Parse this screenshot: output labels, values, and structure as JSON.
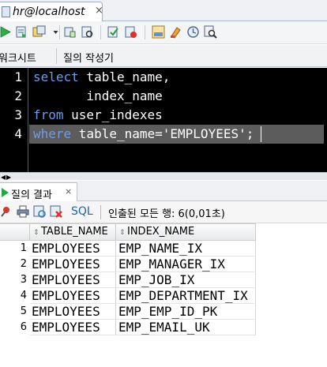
{
  "window": {
    "connection_tab_title": "hr@localhost",
    "connection_tab_close": "×"
  },
  "toolbar": {
    "icons": [
      "run-statement-icon",
      "run-script-icon",
      "commit-icon",
      "dropdown-icon",
      "autotrace-icon",
      "explain-plan-icon",
      "commit-icon",
      "rollback-icon",
      "sql-tuning-icon",
      "clear-icon",
      "history-icon",
      "find-icon"
    ]
  },
  "worksheet_tabs": {
    "worksheet": "워크시트",
    "query_builder": "질의 작성기"
  },
  "editor": {
    "line_numbers": [
      "1",
      "2",
      "3",
      "4"
    ],
    "lines": [
      {
        "kw": "select",
        "rest": " table_name,"
      },
      {
        "kw": "",
        "rest": "       index_name"
      },
      {
        "kw": "from",
        "rest": " user_indexes"
      },
      {
        "kw": "where",
        "rest": " table_name='EMPLOYEES';"
      }
    ]
  },
  "results_tab": {
    "label": "질의 결과",
    "close": "×"
  },
  "results_toolbar": {
    "sql_button": "SQL",
    "status": "인출된 모든 행: 6(0,01초)"
  },
  "grid": {
    "columns": [
      "TABLE_NAME",
      "INDEX_NAME"
    ],
    "rows": [
      {
        "n": "1",
        "table_name": "EMPLOYEES",
        "index_name": "EMP_NAME_IX"
      },
      {
        "n": "2",
        "table_name": "EMPLOYEES",
        "index_name": "EMP_MANAGER_IX"
      },
      {
        "n": "3",
        "table_name": "EMPLOYEES",
        "index_name": "EMP_JOB_IX"
      },
      {
        "n": "4",
        "table_name": "EMPLOYEES",
        "index_name": "EMP_DEPARTMENT_IX"
      },
      {
        "n": "5",
        "table_name": "EMPLOYEES",
        "index_name": "EMP_EMP_ID_PK"
      },
      {
        "n": "6",
        "table_name": "EMPLOYEES",
        "index_name": "EMP_EMAIL_UK"
      }
    ]
  },
  "colors": {
    "keyword": "#6f9bea",
    "editor_bg": "#000000",
    "current_line": "#5c5c5c",
    "sql_link": "#1b63b6"
  }
}
